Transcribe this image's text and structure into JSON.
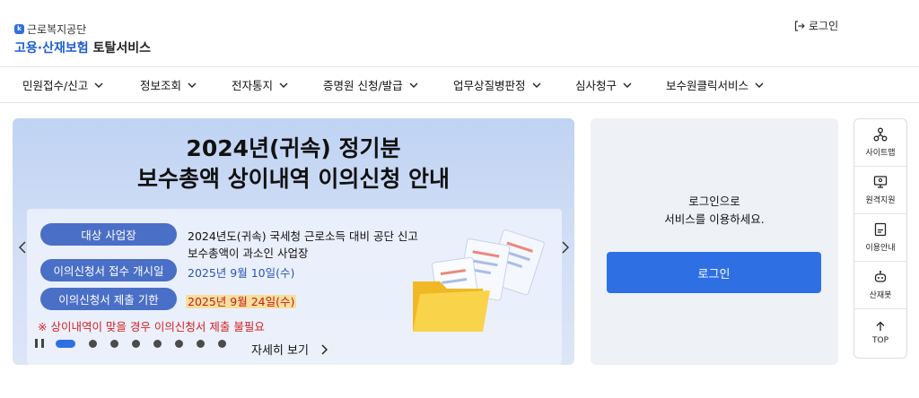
{
  "header": {
    "logo_org": "근로복지공단",
    "logo_brand": "고용·산재보험",
    "logo_service": "토탈서비스",
    "login_label": "로그인"
  },
  "nav": {
    "items": [
      {
        "label": "민원접수/신고"
      },
      {
        "label": "정보조회"
      },
      {
        "label": "전자통지"
      },
      {
        "label": "증명원 신청/발급"
      },
      {
        "label": "업무상질병판정"
      },
      {
        "label": "심사청구"
      },
      {
        "label": "보수원클릭서비스"
      }
    ]
  },
  "banner": {
    "title_line1": "2024년(귀속) 정기분",
    "title_line2": "보수총액 상이내역  이의신청 안내",
    "rows": [
      {
        "pill": "대상 사업장",
        "text1": "2024년도(귀속) 국세청 근로소득 대비 공단 신고",
        "text2": "보수총액이 과소인 사업장"
      },
      {
        "pill": "이의신청서 접수 개시일",
        "text": "2025년 9월 10일(수)"
      },
      {
        "pill": "이의신청서 제출 기한",
        "text": "2025년 9월 24일(수)"
      }
    ],
    "note": "※ 상이내역이 맞을 경우 이의신청서 제출 불필요",
    "more_label": "자세히 보기",
    "slide_count": 9,
    "active_slide": 1
  },
  "login_panel": {
    "message_line1": "로그인으로",
    "message_line2": "서비스를 이용하세요.",
    "button_label": "로그인"
  },
  "quick_menu": {
    "items": [
      {
        "label": "사이트맵",
        "icon": "sitemap-icon"
      },
      {
        "label": "원격지원",
        "icon": "remote-support-icon"
      },
      {
        "label": "이용안내",
        "icon": "guide-icon"
      },
      {
        "label": "산재봇",
        "icon": "chatbot-icon"
      },
      {
        "label": "TOP",
        "icon": "arrow-up-icon"
      }
    ]
  },
  "colors": {
    "accent": "#2f6fe4",
    "pill": "#4a6fc7",
    "warning": "#d42020",
    "highlight": "#f7df9c"
  }
}
